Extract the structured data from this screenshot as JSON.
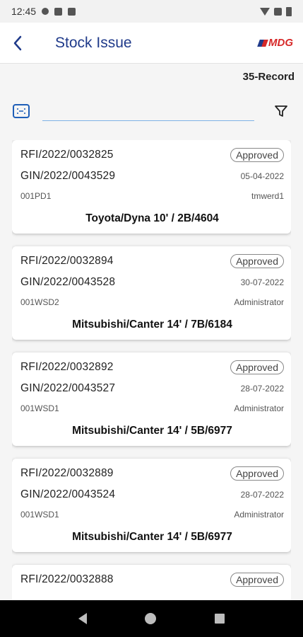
{
  "status_bar": {
    "time": "12:45"
  },
  "app_bar": {
    "title": "Stock Issue",
    "logo_text": "MDG"
  },
  "record_count": "35-Record",
  "search": {
    "value": "",
    "placeholder": ""
  },
  "colors": {
    "primary": "#1f3a8a",
    "accent": "#d62828",
    "input_underline": "#7fb3e6"
  },
  "cards": [
    {
      "rfi": "RFI/2022/0032825",
      "status": "Approved",
      "gin": "GIN/2022/0043529",
      "date": "05-04-2022",
      "code": "001PD1",
      "user": "tmwerd1",
      "vehicle": "Toyota/Dyna 10' / 2B/4604"
    },
    {
      "rfi": "RFI/2022/0032894",
      "status": "Approved",
      "gin": "GIN/2022/0043528",
      "date": "30-07-2022",
      "code": "001WSD2",
      "user": "Administrator",
      "vehicle": "Mitsubishi/Canter 14' / 7B/6184"
    },
    {
      "rfi": "RFI/2022/0032892",
      "status": "Approved",
      "gin": "GIN/2022/0043527",
      "date": "28-07-2022",
      "code": "001WSD1",
      "user": "Administrator",
      "vehicle": "Mitsubishi/Canter 14' / 5B/6977"
    },
    {
      "rfi": "RFI/2022/0032889",
      "status": "Approved",
      "gin": "GIN/2022/0043524",
      "date": "28-07-2022",
      "code": "001WSD1",
      "user": "Administrator",
      "vehicle": "Mitsubishi/Canter 14' / 5B/6977"
    },
    {
      "rfi": "RFI/2022/0032888",
      "status": "Approved",
      "gin": "",
      "date": "",
      "code": "",
      "user": "",
      "vehicle": ""
    }
  ],
  "icons": {
    "back": "chevron-left-icon",
    "scan": "scan-icon",
    "filter": "filter-icon",
    "nav_back": "triangle-back-icon",
    "nav_home": "circle-home-icon",
    "nav_recent": "square-recent-icon"
  }
}
